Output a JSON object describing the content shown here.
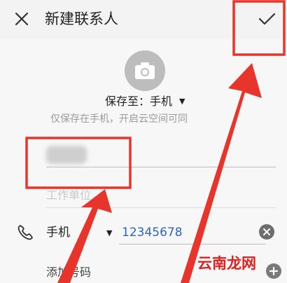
{
  "header": {
    "title": "新建联系人",
    "close_icon": "close-icon",
    "confirm_icon": "check-icon"
  },
  "avatar": {
    "icon": "camera-icon"
  },
  "save": {
    "label": "保存至：手机",
    "hint": "仅保存在手机，开启云空间可同"
  },
  "fields": {
    "company_placeholder": "工作单位"
  },
  "phone": {
    "type": "手机",
    "value": "12345678",
    "icon": "phone-icon"
  },
  "add_number": {
    "label": "添加号码"
  },
  "watermark": {
    "text": "云南龙网"
  },
  "colors": {
    "annotation_red": "#e8352b",
    "phone_value_blue": "#2a66c4"
  }
}
